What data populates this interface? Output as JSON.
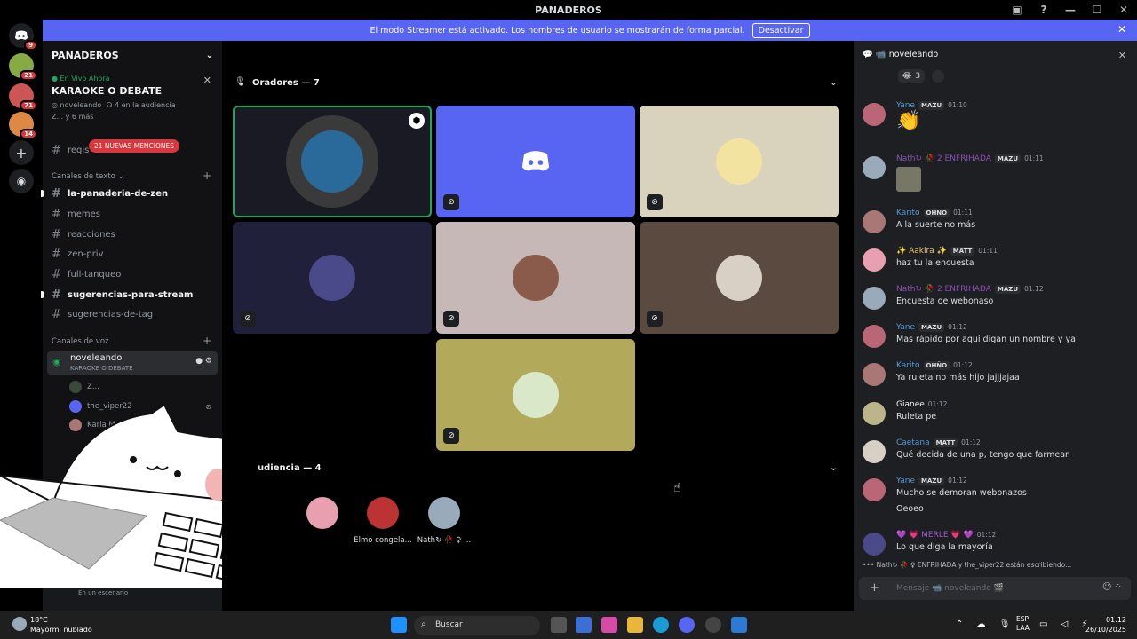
{
  "window": {
    "title": "PANADEROS",
    "min": "—",
    "max": "☐",
    "close": "✕"
  },
  "banner": {
    "text": "El modo Streamer está activado. Los nombres de usuario se mostrarán de forma parcial.",
    "button": "Desactivar"
  },
  "guilds": [
    {
      "name": "home",
      "badge": "9",
      "color": "#5865f2"
    },
    {
      "name": "guild-1",
      "badge": "21",
      "color": "#8a4"
    },
    {
      "name": "guild-2",
      "badge": "71",
      "color": "#c55"
    },
    {
      "name": "guild-3",
      "badge": "14",
      "color": "#d84"
    }
  ],
  "sidebar": {
    "server": "PANADEROS",
    "live_label": "En Vivo Ahora",
    "live_title": "KARAOKE O DEBATE",
    "live_host": "noveleando",
    "live_audience": "4 en la audiencia",
    "live_more": "Z... y 6 más",
    "mentions": "21 NUEVAS MENCIONES",
    "registry_channel": "regis",
    "text_category": "Canales de texto",
    "channels": [
      {
        "name": "la-panaderia-de-zen",
        "unread": true
      },
      {
        "name": "memes",
        "unread": false
      },
      {
        "name": "reacciones",
        "unread": false
      },
      {
        "name": "zen-priv",
        "unread": false
      },
      {
        "name": "full-tanqueo",
        "unread": false
      },
      {
        "name": "sugerencias-para-stream",
        "unread": true
      },
      {
        "name": "sugerencias-de-tag",
        "unread": false
      }
    ],
    "voice_category": "Canales de voz",
    "voice_channel": "noveleando",
    "voice_sub": "KARAOKE O DEBATE",
    "voice_users": [
      "Z...",
      "the_viper22",
      "Karla M"
    ],
    "status": "En un escenario"
  },
  "stage": {
    "speakers_title": "Oradores — 7",
    "audience_title": "udiencia — 4",
    "audience": [
      {
        "name": "",
        "color": "#e8a0b0"
      },
      {
        "name": "Elmo congela...",
        "color": "#b33"
      },
      {
        "name": "Nath↻ 🥀 ♀ ...",
        "color": "#9ab"
      }
    ]
  },
  "chat": {
    "header": "noveleando",
    "reaction_count": "3",
    "messages": [
      {
        "name": "Yane",
        "color": "#4e9bd9",
        "tag": "MAZU",
        "time": "01:10",
        "text": "👏"
      },
      {
        "name": "Nath↻ 🥀 2 ENFRIHADA",
        "color": "#8a4fb8",
        "tag": "MAZU",
        "time": "01:11",
        "text": ""
      },
      {
        "name": "Karito",
        "color": "#4e9bd9",
        "tag": "OHÑO",
        "time": "01:11",
        "text": "A la suerte no más"
      },
      {
        "name": "✨ Aakira ✨",
        "color": "#e8c76a",
        "tag": "MATT",
        "time": "01:11",
        "text": "haz tu la encuesta"
      },
      {
        "name": "Nath↻ 🥀 2 ENFRIHADA",
        "color": "#8a4fb8",
        "tag": "MAZU",
        "time": "01:12",
        "text": "Encuesta oe webonaso"
      },
      {
        "name": "Yane",
        "color": "#4e9bd9",
        "tag": "MAZU",
        "time": "01:12",
        "text": "Mas rápido por aquí digan un nombre y ya"
      },
      {
        "name": "Karito",
        "color": "#4e9bd9",
        "tag": "OHÑO",
        "time": "01:12",
        "text": "Ya ruleta no más hijo jajjjajaa"
      },
      {
        "name": "Gianee",
        "color": "#f2f3f5",
        "tag": "",
        "time": "01:12",
        "text": "Ruleta pe"
      },
      {
        "name": "Caetana",
        "color": "#4e9bd9",
        "tag": "MATT",
        "time": "01:12",
        "text": "Qué decida de una p, tengo que farmear"
      },
      {
        "name": "Yane",
        "color": "#4e9bd9",
        "tag": "MAZU",
        "time": "01:12",
        "text": "Mucho se demoran webonazos"
      },
      {
        "name": "",
        "color": "#4e9bd9",
        "tag": "",
        "time": "",
        "text": "Oeoeo"
      },
      {
        "name": "💜 💗 MERLE 💗 💜",
        "color": "#9b59d0",
        "tag": "",
        "time": "01:12",
        "text": "Lo que diga la mayoría"
      }
    ],
    "typing": "Nath↻ 🥀 ♀ ENFRIHADA y the_viper22 están escribiendo...",
    "placeholder": "Mensaje 📹 noveleando 🎬"
  },
  "taskbar": {
    "temp": "18°C",
    "weather": "Mayorm. nublado",
    "search": "Buscar",
    "lang1": "ESP",
    "lang2": "LAA",
    "time": "01:12",
    "date": "26/10/2025"
  }
}
